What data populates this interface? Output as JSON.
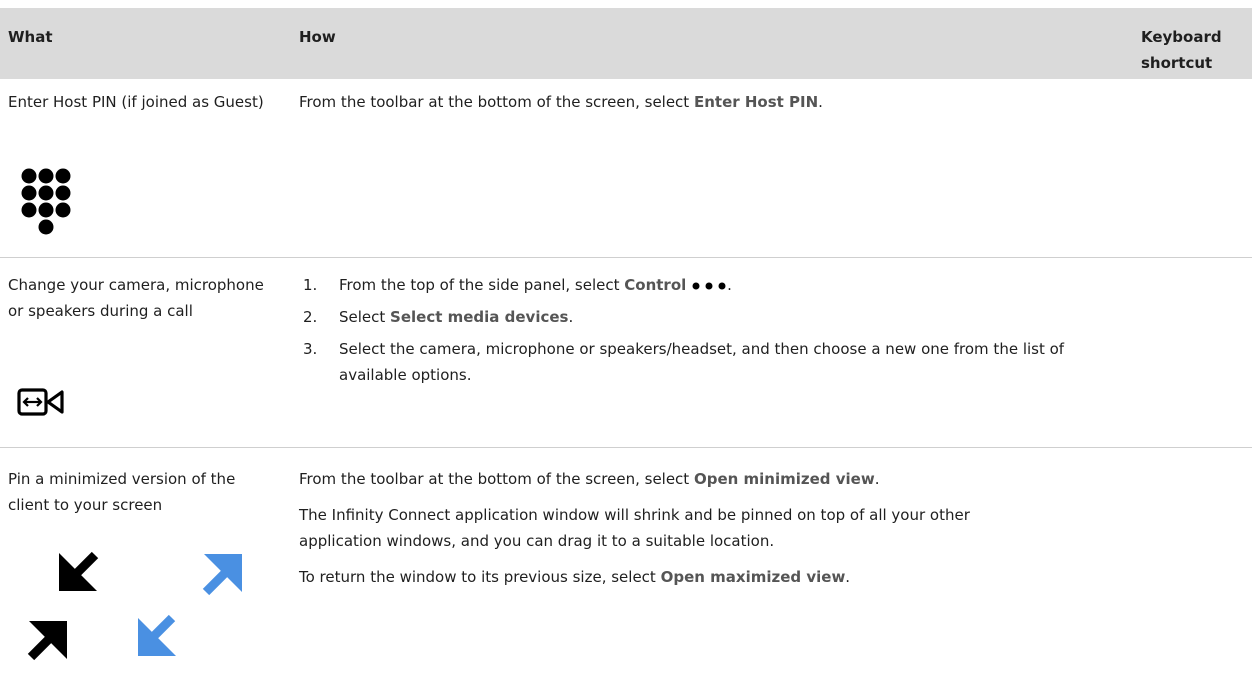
{
  "table": {
    "headers": {
      "what": "What",
      "how": "How",
      "keyboard_shortcut": "Keyboard shortcut"
    },
    "rows": [
      {
        "what": "Enter Host PIN (if joined as Guest)",
        "icon": "keypad-icon",
        "how": {
          "prefix": "From the toolbar at the bottom of the screen, select ",
          "ui_label": "Enter Host PIN",
          "suffix": "."
        }
      },
      {
        "what": "Change your camera, microphone or speakers during a call",
        "icon": "switch-camera-icon",
        "steps": [
          {
            "num": "1.",
            "prefix": "From the top of the side panel, select ",
            "ui_label": "Control",
            "suffix": "."
          },
          {
            "num": "2.",
            "prefix": "Select ",
            "ui_label": "Select media devices",
            "suffix": "."
          },
          {
            "num": "3.",
            "text": "Select the camera, microphone or speakers/headset, and then choose a new one from the list of available options."
          }
        ]
      },
      {
        "what": "Pin a minimized version of the client to your screen",
        "icons": [
          "minimize-arrows-icon",
          "maximize-arrows-icon"
        ],
        "how": {
          "p1_prefix": "From the toolbar at the bottom of the screen, select ",
          "p1_ui": "Open minimized view",
          "p1_suffix": ".",
          "p2": "The Infinity Connect application window will shrink and be pinned on top of all your other application windows, and you can drag it to a suitable location.",
          "p3_prefix": "To return the window to its previous size, select ",
          "p3_ui": "Open maximized view",
          "p3_suffix": "."
        }
      }
    ]
  },
  "colors": {
    "header_bg": "#dadada",
    "ui_label": "#555555",
    "icon_black": "#000000",
    "icon_blue": "#4a90e2"
  }
}
